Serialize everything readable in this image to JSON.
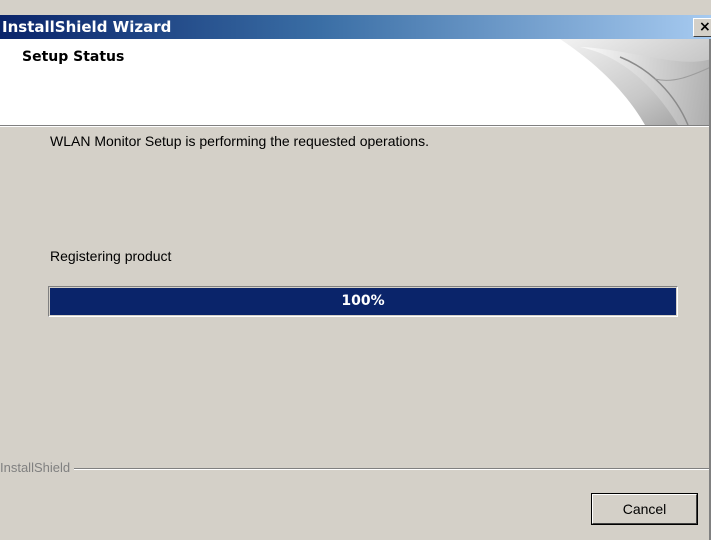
{
  "window": {
    "title": "InstallShield Wizard",
    "close_glyph": "×"
  },
  "header": {
    "title": "Setup Status",
    "graphic_icon": "page-curl-icon"
  },
  "main": {
    "status_text": "WLAN Monitor Setup is performing the requested operations.",
    "action_text": "Registering product",
    "progress": {
      "percent": 100,
      "label": "100%"
    }
  },
  "footer": {
    "brand": "InstallShield",
    "cancel_label": "Cancel"
  },
  "colors": {
    "title_start": "#0a246a",
    "title_end": "#a6caf0",
    "progress_fill": "#0a246a",
    "face": "#d4d0c8"
  }
}
